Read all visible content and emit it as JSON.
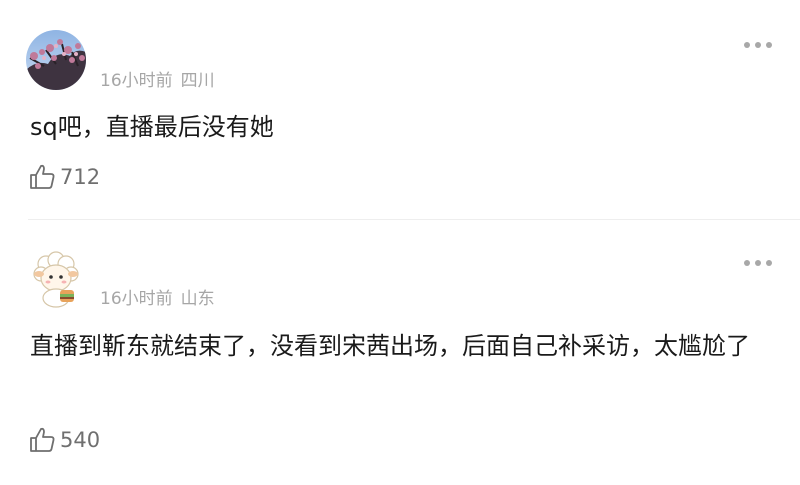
{
  "comments": [
    {
      "avatar_icon": "blossom-tree-photo-avatar",
      "time": "16小时前",
      "location": "四川",
      "text": "sq吧，直播最后没有她",
      "likes": "712",
      "more_icon": "more-dots-icon",
      "like_icon": "thumbs-up-icon"
    },
    {
      "avatar_icon": "cartoon-sheep-avatar",
      "time": "16小时前",
      "location": "山东",
      "text": "直播到靳东就结束了，没看到宋茜出场，后面自己补采访，太尴尬了",
      "likes": "540",
      "more_icon": "more-dots-icon",
      "like_icon": "thumbs-up-icon"
    }
  ],
  "colors": {
    "meta_text": "#a6a6a6",
    "body_text": "#1a1a1a",
    "like_text": "#6f6f6f",
    "divider": "#eeeeee"
  }
}
